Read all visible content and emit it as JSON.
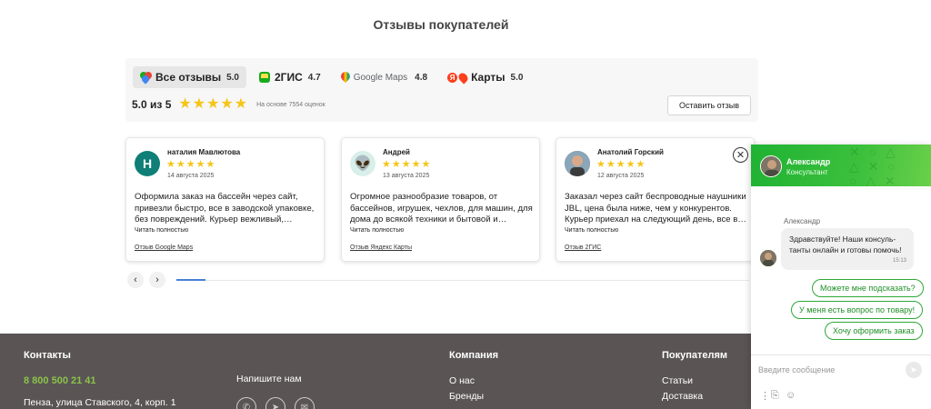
{
  "section_title": "Отзывы покупателей",
  "tabs": [
    {
      "label": "Все отзывы",
      "score": "5.0",
      "icon": "all-reviews-icon"
    },
    {
      "label": "2ГИС",
      "score": "4.7",
      "icon": "2gis-logo-icon"
    },
    {
      "label": "Google Maps",
      "score": "4.8",
      "icon": "google-maps-icon"
    },
    {
      "label": "Карты",
      "score": "5.0",
      "icon": "yandex-maps-icon"
    }
  ],
  "summary": {
    "rating": "5.0 из 5",
    "stars": 5,
    "based_on": "На основе 7554 оценок",
    "leave_review": "Оставить отзыв"
  },
  "reviews": [
    {
      "author": "наталия Мавлютова",
      "avatar_letter": "Н",
      "avatar_color": "#0f7f77",
      "date": "14 августа 2025",
      "text": "Оформила заказ на бассейн через сайт, привезли быстро, все в заводской упаковке, без повреждений. Курьер вежливый,…",
      "more": "Читать полностью",
      "source": "Отзыв Google Maps"
    },
    {
      "author": "Андрей",
      "avatar_letter": "👽",
      "avatar_color": "#d9efe9",
      "date": "13 августа 2025",
      "text": "Огромное разнообразие товаров, от бассейнов, игрушек, чехлов, для машин, для дома до всякой техники и бытовой и…",
      "more": "Читать полностью",
      "source": "Отзыв Яндекс Карты"
    },
    {
      "author": "Анатолий Горский",
      "avatar_letter": "",
      "avatar_color": "#7a6a5a",
      "date": "12 августа 2025",
      "text": "Заказал через сайт беспроводные наушники JBL, цена была ниже, чем у конкурентов. Курьер приехал на следующий день, все в…",
      "more": "Читать полностью",
      "source": "Отзыв 2ГИС"
    }
  ],
  "carousel": {
    "prev": "‹",
    "next": "›",
    "progress": 0.05
  },
  "footer": {
    "contacts_title": "Контакты",
    "phone": "8 800 500 21 41",
    "write_us": "Напишите нам",
    "address": "Пенза, улица Ставского, 4, корп. 1",
    "company_title": "Компания",
    "company_links": [
      "О нас",
      "Бренды"
    ],
    "buyers_title": "Покупателям",
    "buyers_links": [
      "Статьи",
      "Доставка"
    ],
    "phone_color": "#8bc34a"
  },
  "chat": {
    "name": "Александр",
    "role": "Консультант",
    "sender": "Александр",
    "message": "Здравствуйте! Наши консуль-танты онлайн и готовы помочь!",
    "time": "15:13",
    "quick_replies": [
      "Можете мне подсказать?",
      "У меня есть вопрос по товару!",
      "Хочу оформить заказ"
    ],
    "input_placeholder": "Введите сообщение",
    "accent": "#2ea836"
  }
}
